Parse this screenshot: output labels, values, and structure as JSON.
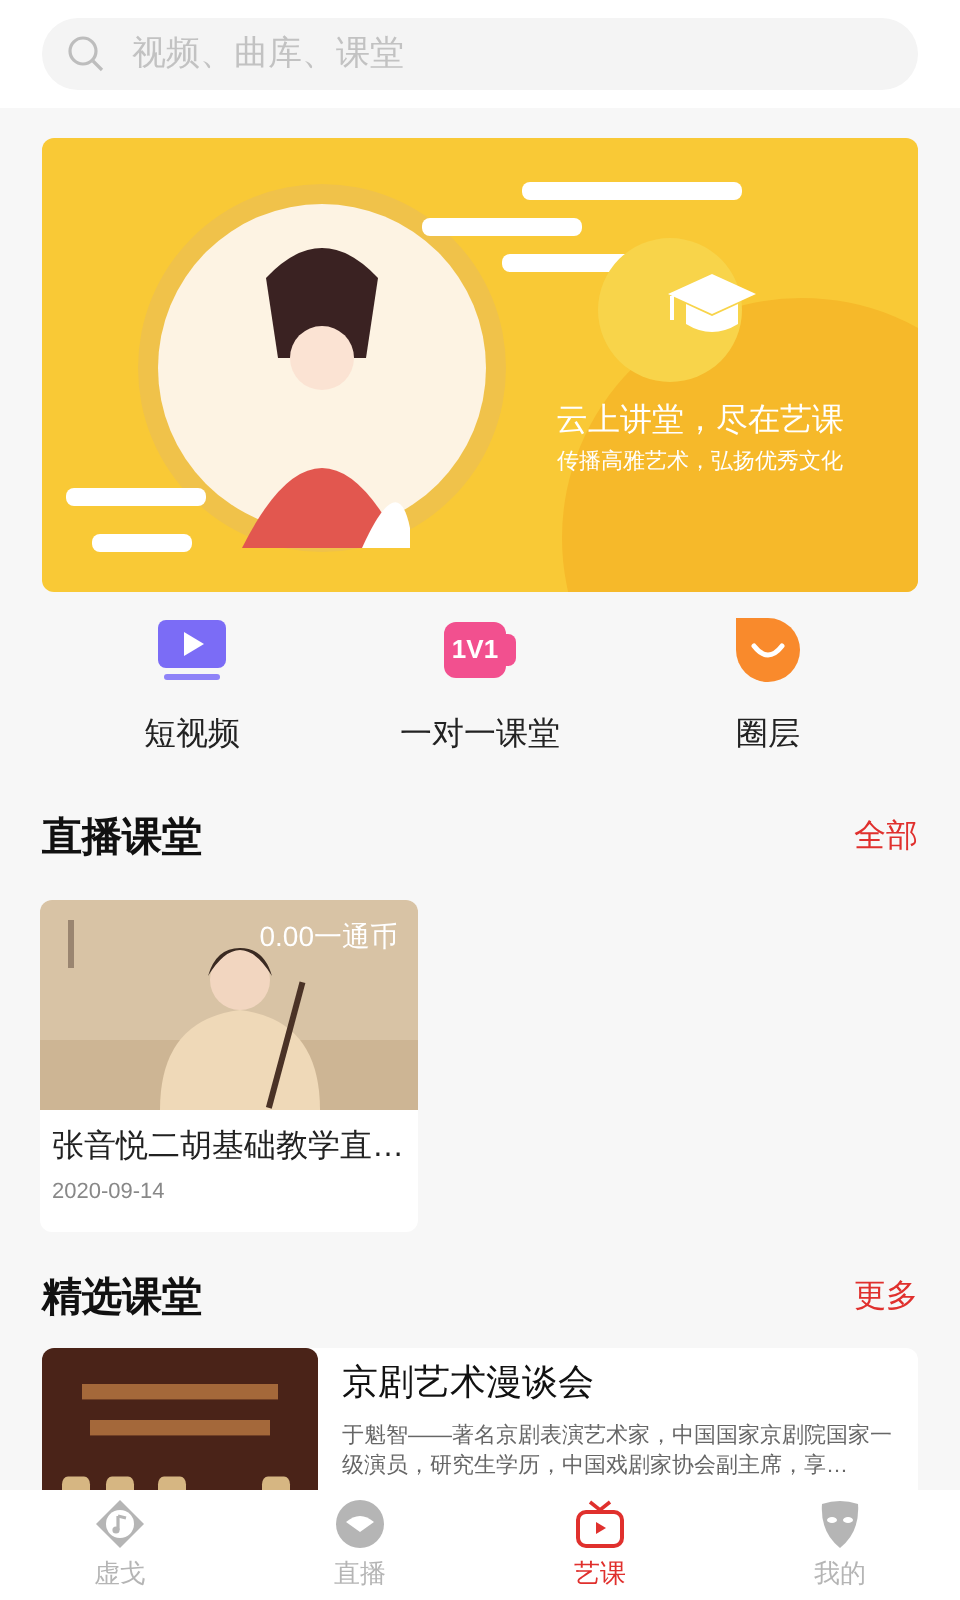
{
  "search": {
    "placeholder": "视频、曲库、课堂"
  },
  "banner": {
    "kind": "picture",
    "headline": "云上讲堂，尽在艺课",
    "tagline": "传播高雅艺术，弘扬优秀文化"
  },
  "shortcuts": [
    {
      "kind": "video",
      "label": "短视频"
    },
    {
      "kind": "one_on_one",
      "label": "一对一课堂",
      "badge": "1V1"
    },
    {
      "kind": "circle",
      "label": "圈层"
    }
  ],
  "live": {
    "title": "直播课堂",
    "more": "全部",
    "items": [
      {
        "price": "0.00一通币",
        "title": "张音悦二胡基础教学直…",
        "date": "2020-09-14"
      }
    ]
  },
  "featured": {
    "title": "精选课堂",
    "more": "更多",
    "items": [
      {
        "title": "京剧艺术漫谈会",
        "description": "于魁智——著名京剧表演艺术家，中国国家京剧院国家一级演员，研究生学历，中国戏剧家协会副主席，享…"
      }
    ]
  },
  "tabs": [
    {
      "kind": "music",
      "label": "虚戈",
      "selected": false
    },
    {
      "kind": "fan",
      "label": "直播",
      "selected": false
    },
    {
      "kind": "tv",
      "label": "艺课",
      "selected": true
    },
    {
      "kind": "mask",
      "label": "我的",
      "selected": false
    }
  ]
}
